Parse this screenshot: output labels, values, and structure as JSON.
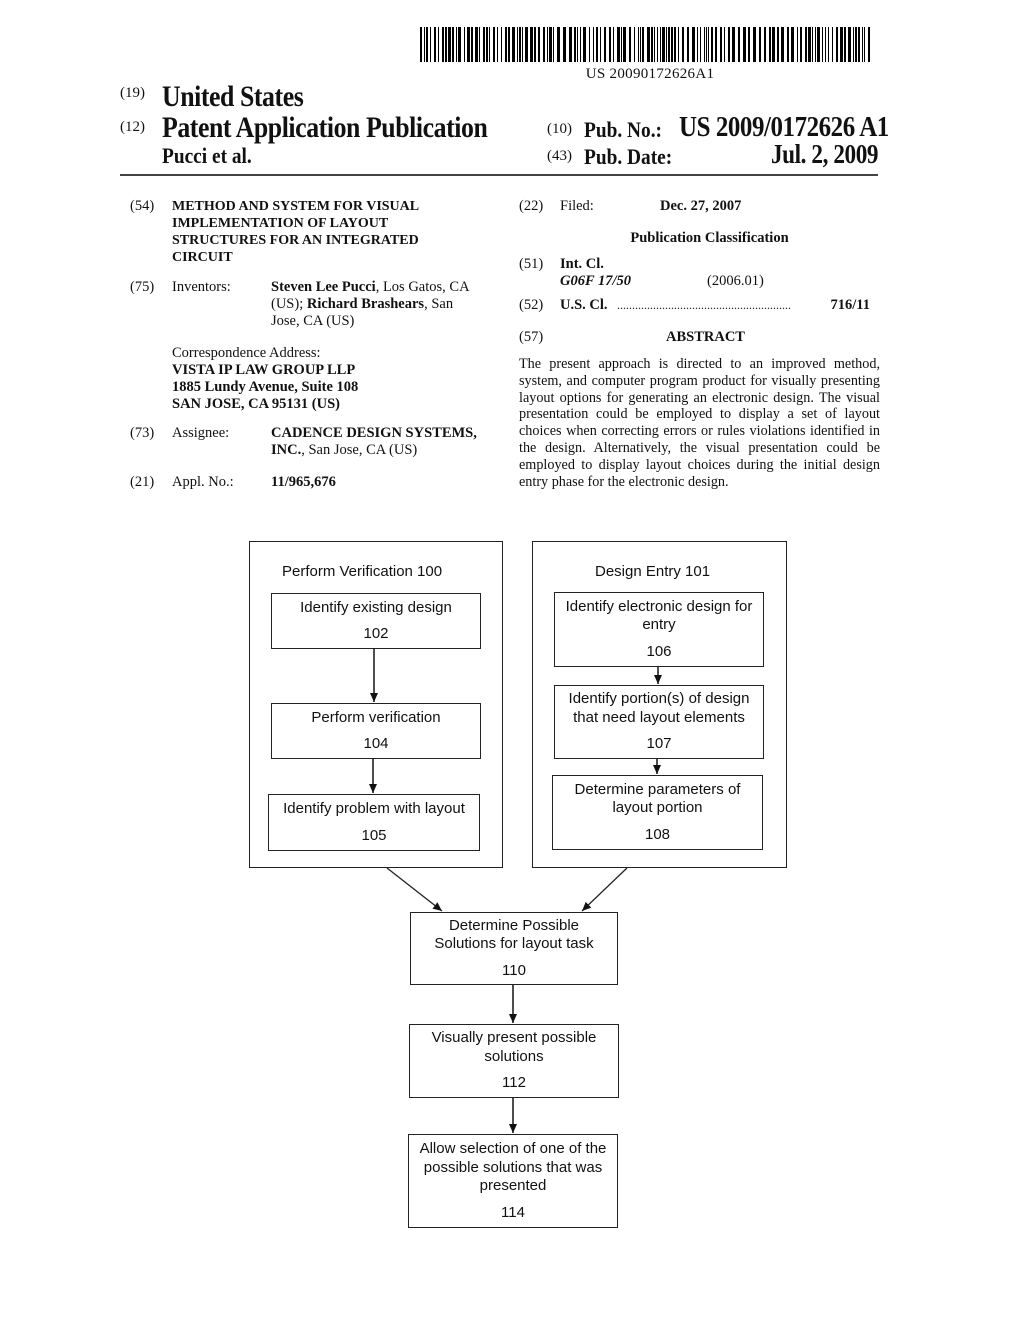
{
  "header": {
    "barcode_text": "US 20090172626A1",
    "country_code": "(19)",
    "country": "United States",
    "type_code": "(12)",
    "type": "Patent Application Publication",
    "authors": "Pucci et al.",
    "pub_no_code": "(10)",
    "pub_no_label": "Pub. No.:",
    "pub_no": "US 2009/0172626 A1",
    "pub_date_code": "(43)",
    "pub_date_label": "Pub. Date:",
    "pub_date": "Jul. 2, 2009"
  },
  "left": {
    "title_code": "(54)",
    "title_lines": [
      "METHOD AND SYSTEM FOR VISUAL",
      "IMPLEMENTATION OF LAYOUT",
      "STRUCTURES FOR AN INTEGRATED",
      "CIRCUIT"
    ],
    "inventors_code": "(75)",
    "inventors_label": "Inventors:",
    "inventor1_name": "Steven Lee Pucci",
    "inventor1_loc": ", Los Gatos, CA",
    "inventor1_country": "(US); ",
    "inventor2_name": "Richard Brashears",
    "inventor2_loc": ", San",
    "inventor2_loc2": "Jose, CA (US)",
    "correspondence_label": "Correspondence Address:",
    "correspondence_lines": [
      "VISTA IP LAW GROUP LLP",
      "1885 Lundy Avenue, Suite 108",
      "SAN JOSE, CA 95131 (US)"
    ],
    "assignee_code": "(73)",
    "assignee_label": "Assignee:",
    "assignee_name": "CADENCE DESIGN SYSTEMS,",
    "assignee_name2": "INC.",
    "assignee_loc": ", San Jose, CA (US)",
    "appl_code": "(21)",
    "appl_label": "Appl. No.:",
    "appl_no": "11/965,676"
  },
  "right": {
    "filed_code": "(22)",
    "filed_label": "Filed:",
    "filed_date": "Dec. 27, 2007",
    "classification_heading": "Publication Classification",
    "intcl_code": "(51)",
    "intcl_label": "Int. Cl.",
    "intcl_class": "G06F 17/50",
    "intcl_year": "(2006.01)",
    "uscl_code": "(52)",
    "uscl_label": "U.S. Cl.",
    "uscl_dots": "..........................................................",
    "uscl_value": "716/11",
    "abstract_code": "(57)",
    "abstract_heading": "ABSTRACT",
    "abstract_text": "The present approach is directed to an improved method, system, and computer program product for visually presenting layout options for generating an electronic design. The visual presentation could be employed to display a set of layout choices when correcting errors or rules violations identified in the design. Alternatively, the visual presentation could be employed to display layout choices during the initial design entry phase for the electronic design."
  },
  "flowchart": {
    "groups": [
      {
        "title": "Perform Verification 100"
      },
      {
        "title": "Design Entry 101"
      }
    ],
    "steps": [
      {
        "id": "102",
        "text": "Identify existing design"
      },
      {
        "id": "104",
        "text": "Perform verification"
      },
      {
        "id": "105",
        "text": "Identify problem with layout"
      },
      {
        "id": "106",
        "text": "Identify electronic design for\nentry"
      },
      {
        "id": "107",
        "text": "Identify portion(s) of design\nthat need layout elements"
      },
      {
        "id": "108",
        "text": "Determine parameters of\nlayout portion"
      },
      {
        "id": "110",
        "text": "Determine Possible\nSolutions for layout task"
      },
      {
        "id": "112",
        "text": "Visually present possible\nsolutions"
      },
      {
        "id": "114",
        "text": "Allow selection of one of the\npossible solutions that was\npresented"
      }
    ]
  }
}
